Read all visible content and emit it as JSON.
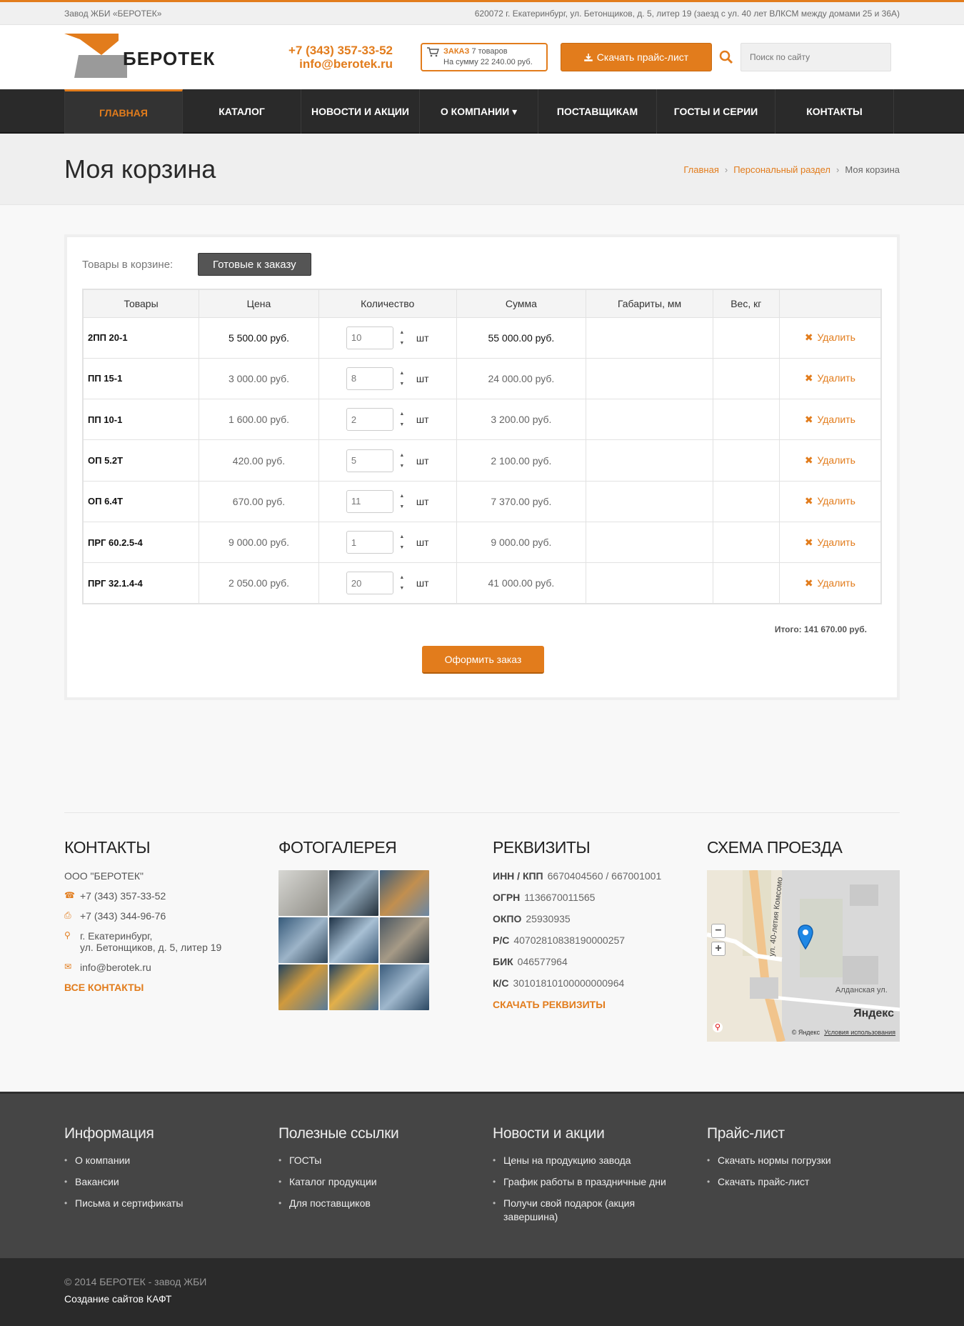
{
  "topbar": {
    "left": "Завод ЖБИ «БЕРОТЕК»",
    "right": "620072 г. Екатеринбург, ул. Бетонщиков, д. 5, литер 19 (заезд с ул. 40 лет ВЛКСМ между домами 25 и 36А)"
  },
  "header": {
    "logo_text": "БЕРОТЕК",
    "phone": "+7 (343) 357-33-52",
    "email": "info@berotek.ru",
    "order_label": "ЗАКАЗ",
    "order_count": "7 товаров",
    "order_sum_label": "На сумму",
    "order_sum": "22 240.00 руб.",
    "price_button": "Скачать прайс-лист",
    "search_placeholder": "Поиск по сайту"
  },
  "nav": [
    {
      "label": "ГЛАВНАЯ"
    },
    {
      "label": "КАТАЛОГ"
    },
    {
      "label": "НОВОСТИ И АКЦИИ"
    },
    {
      "label": "О КОМПАНИИ ▾"
    },
    {
      "label": "ПОСТАВЩИКАМ"
    },
    {
      "label": "ГОСТЫ И СЕРИИ"
    },
    {
      "label": "КОНТАКТЫ"
    }
  ],
  "page": {
    "title": "Моя корзина",
    "breadcrumb": [
      "Главная",
      "Персональный раздел",
      "Моя корзина"
    ]
  },
  "cart": {
    "label": "Товары в корзине:",
    "tab": "Готовые к заказу",
    "columns": [
      "Товары",
      "Цена",
      "Количество",
      "Сумма",
      "Габариты, мм",
      "Вес, кг",
      ""
    ],
    "unit": "шт",
    "delete_label": "Удалить",
    "rows": [
      {
        "name": "2ПП 20-1",
        "price": "5 500.00 руб.",
        "qty": "10",
        "sum": "55 000.00 руб."
      },
      {
        "name": "ПП 15-1",
        "price": "3 000.00 руб.",
        "qty": "8",
        "sum": "24 000.00 руб."
      },
      {
        "name": "ПП 10-1",
        "price": "1 600.00 руб.",
        "qty": "2",
        "sum": "3 200.00 руб."
      },
      {
        "name": "ОП 5.2Т",
        "price": "420.00 руб.",
        "qty": "5",
        "sum": "2 100.00 руб."
      },
      {
        "name": "ОП 6.4Т",
        "price": "670.00 руб.",
        "qty": "11",
        "sum": "7 370.00 руб."
      },
      {
        "name": "ПРГ 60.2.5-4",
        "price": "9 000.00 руб.",
        "qty": "1",
        "sum": "9 000.00 руб."
      },
      {
        "name": "ПРГ 32.1.4-4",
        "price": "2 050.00 руб.",
        "qty": "20",
        "sum": "41 000.00 руб."
      }
    ],
    "total": "Итого: 141 670.00 руб.",
    "order_button": "Оформить заказ"
  },
  "footer": {
    "contacts": {
      "title": "КОНТАКТЫ",
      "company": "ООО \"БЕРОТЕК\"",
      "phone": "+7 (343) 357-33-52",
      "fax": "+7 (343) 344-96-76",
      "address1": "г. Екатеринбург,",
      "address2": "ул. Бетонщиков, д. 5, литер 19",
      "email": "info@berotek.ru",
      "all_link": "ВСЕ КОНТАКТЫ"
    },
    "gallery": {
      "title": "ФОТОГАЛЕРЕЯ"
    },
    "requisites": {
      "title": "РЕКВИЗИТЫ",
      "items": [
        {
          "k": "ИНН / КПП",
          "v": "6670404560 / 667001001"
        },
        {
          "k": "ОГРН",
          "v": "1136670011565"
        },
        {
          "k": "ОКПО",
          "v": "25930935"
        },
        {
          "k": "Р/С",
          "v": "40702810838190000257"
        },
        {
          "k": "БИК",
          "v": "046577964"
        },
        {
          "k": "К/С",
          "v": "30101810100000000964"
        }
      ],
      "download": "СКАЧАТЬ РЕКВИЗИТЫ"
    },
    "map": {
      "title": "СХЕМА ПРОЕЗДА",
      "street1": "ул. 40-летия Комсомо",
      "street2": "Алданская ул.",
      "brand": "Яндекс",
      "copyright": "© Яндекс",
      "terms": "Условия использования"
    }
  },
  "footer_dark": {
    "info": {
      "title": "Информация",
      "items": [
        "О компании",
        "Вакансии",
        "Письма и сертификаты"
      ]
    },
    "links": {
      "title": "Полезные ссылки",
      "items": [
        "ГОСТы",
        "Каталог продукции",
        "Для поставщиков"
      ]
    },
    "news": {
      "title": "Новости и акции",
      "items": [
        "Цены на продукцию завода",
        "График работы в праздничные дни",
        "Получи свой подарок (акция завершина)"
      ]
    },
    "price": {
      "title": "Прайс-лист",
      "items": [
        "Скачать нормы погрузки",
        "Скачать прайс-лист"
      ]
    }
  },
  "footer_bottom": {
    "copyright": "© 2014 БЕРОТЕК - завод ЖБИ",
    "dev": "Создание сайтов КАФТ"
  },
  "colors": {
    "accent": "#e27c1c",
    "nav": "#2a2a2a",
    "footer": "#454545"
  }
}
